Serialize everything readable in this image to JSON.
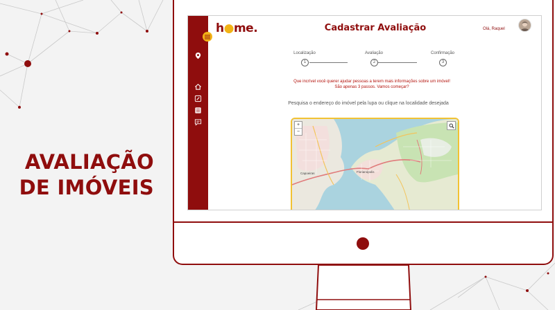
{
  "headline": {
    "line1": "AVALIAÇÃO",
    "line2": "DE IMÓVEIS"
  },
  "app": {
    "logo": {
      "prefix": "h",
      "suffix": "me."
    },
    "page_title": "Cadastrar Avaliação",
    "greeting": "Olá, Raquel",
    "sidebar": {
      "items": [
        {
          "icon": "home-icon"
        },
        {
          "icon": "edit-icon"
        },
        {
          "icon": "list-icon"
        },
        {
          "icon": "chat-icon"
        }
      ]
    },
    "stepper": [
      {
        "label": "Localização",
        "number": "1"
      },
      {
        "label": "Avaliação",
        "number": "2"
      },
      {
        "label": "Confirmação",
        "number": "3"
      }
    ],
    "intro": {
      "line1": "Que incrível você querer ajudar pessoas a terem mais informações sobre um imóvel!",
      "line2": "São apenas 3 passos. Vamos começar?"
    },
    "instruction": "Pesquisa o endereço do imóvel pela lupa ou clique na localidade desejada",
    "map": {
      "zoom_in": "+",
      "zoom_out": "−",
      "labels": {
        "city": "Florianópolis",
        "west": "Capoeiras"
      }
    }
  },
  "colors": {
    "brand": "#8f0d0d",
    "accent": "#f2b316",
    "water": "#aad3df",
    "land": "#eef0e6"
  }
}
